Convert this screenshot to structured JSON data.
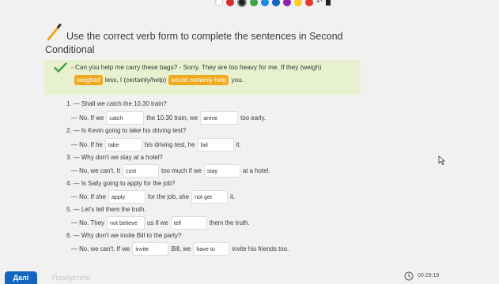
{
  "toolbar": {
    "colors": [
      "#ffffff",
      "#d32f2f",
      "#222222",
      "#43a047",
      "#1e88e5",
      "#1565c0",
      "#8e24aa",
      "#ffca28",
      "#e53935"
    ],
    "selected_color": "#222222",
    "icons": [
      "undo-icon",
      "tool-icon"
    ]
  },
  "task": {
    "icon": "pencil-icon",
    "title_line1": "Use the correct verb form to complete the sentences in Second",
    "title_line2": "Conditional"
  },
  "example": {
    "icon": "check-icon",
    "line1": "- Can you help me carry these bags? - Sorry. They are too heavy for me. If they (weigh)",
    "answer1": "weighed",
    "mid": "less, I (certainly/help)",
    "answer2": "would certainly help",
    "end": "you."
  },
  "items": [
    {
      "question": "1. — Shall we catch the 10.30 train?",
      "parts": [
        "— No. If we",
        "the 10.30 train, we",
        "too early."
      ],
      "answers": [
        "catch",
        "arrive"
      ]
    },
    {
      "question": "2. — Is Kevin going to take his driving test?",
      "parts": [
        "— No. If he",
        "his driving test, he",
        "it."
      ],
      "answers": [
        "take",
        "fail"
      ]
    },
    {
      "question": "3. — Why don't we stay at a hotel?",
      "parts": [
        "— No, we can't. It",
        "too much if we",
        "at a hotel."
      ],
      "answers": [
        "cost",
        "stay"
      ]
    },
    {
      "question": "4. — Is Sally going to apply for the job?",
      "parts": [
        "— No. If she",
        "for the job, she",
        "it."
      ],
      "answers": [
        "apply",
        "not get"
      ]
    },
    {
      "question": "5. — Let's tell them the truth.",
      "parts": [
        "— No. They",
        "us if we",
        "them the truth."
      ],
      "answers": [
        "not believe",
        "tell"
      ]
    },
    {
      "question": "6. — Why don't we invite Bill to the party?",
      "parts": [
        "— No, we can't. If we",
        "Bill, we",
        "invite his friends too."
      ],
      "answers": [
        "invite",
        "have to"
      ]
    }
  ],
  "footer": {
    "next_label": "Далі",
    "skip_label": "Пропустити",
    "timer": "00:29:19",
    "clock_icon": "clock-icon"
  }
}
